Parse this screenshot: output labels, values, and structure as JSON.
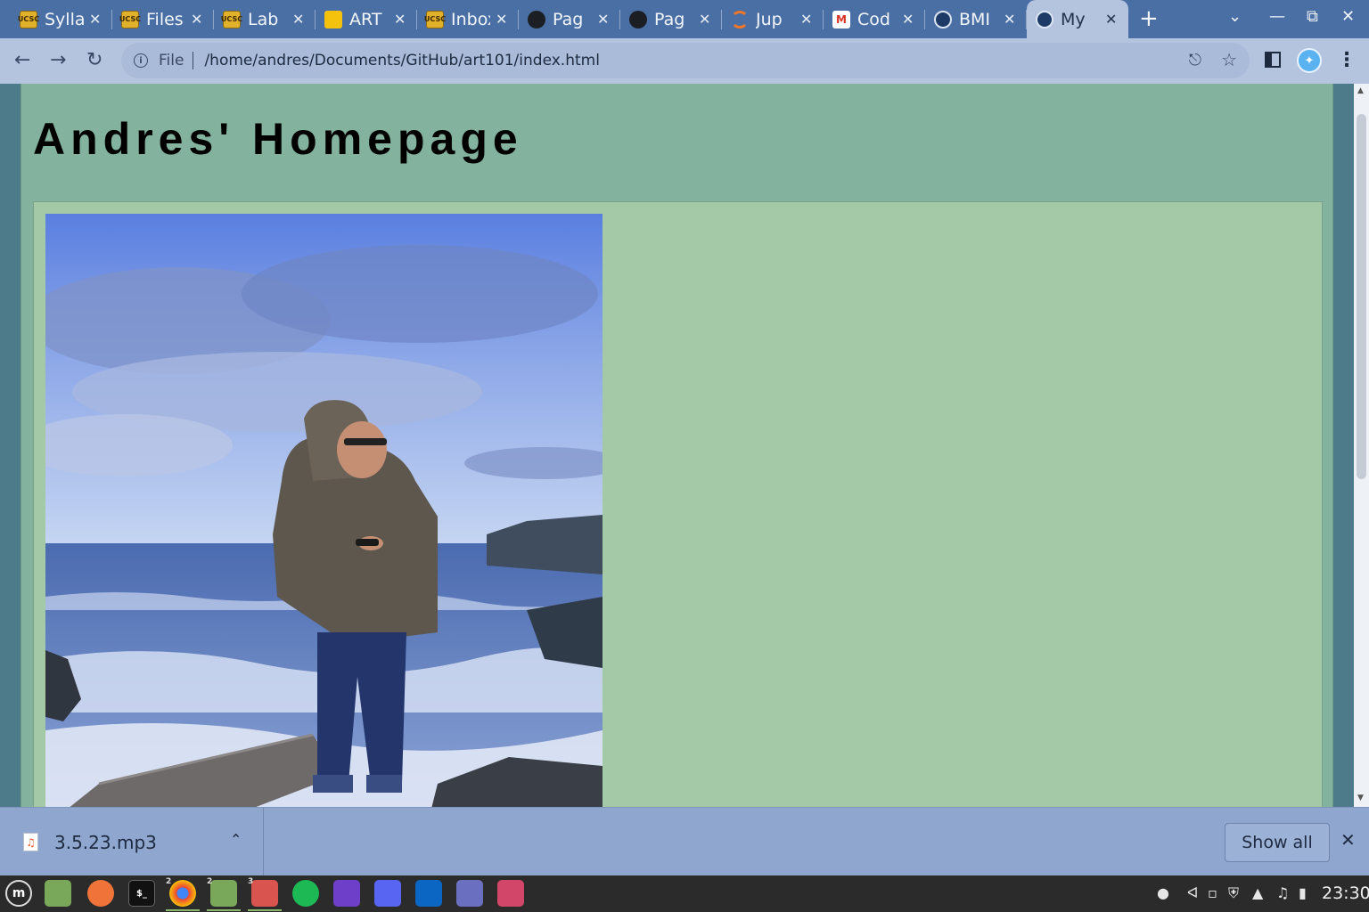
{
  "browser": {
    "tabs": [
      {
        "title": "Syllabus",
        "favicon": "ucsc-icon",
        "kind": "ucsc"
      },
      {
        "title": "Files",
        "favicon": "ucsc-icon",
        "kind": "ucsc"
      },
      {
        "title": "Lab",
        "favicon": "ucsc-icon",
        "kind": "ucsc"
      },
      {
        "title": "ART",
        "favicon": "slides-icon",
        "kind": "slides"
      },
      {
        "title": "Inbox",
        "favicon": "ucsc-icon",
        "kind": "ucsc"
      },
      {
        "title": "Pag",
        "favicon": "github-icon",
        "kind": "gh"
      },
      {
        "title": "Pag",
        "favicon": "github-icon",
        "kind": "gh"
      },
      {
        "title": "Jup",
        "favicon": "jupyter-icon",
        "kind": "jup"
      },
      {
        "title": "Cod",
        "favicon": "gmail-icon",
        "kind": "gmail"
      },
      {
        "title": "BMI",
        "favicon": "globe-icon",
        "kind": "globe"
      },
      {
        "title": "My",
        "favicon": "globe-icon",
        "kind": "globe",
        "active": true
      }
    ],
    "ucsc_badge": "UCSC",
    "address": {
      "scheme_label": "File",
      "url": "/home/andres/Documents/GitHub/art101/index.html"
    }
  },
  "page": {
    "heading": "Andres' Homepage",
    "colors": {
      "page_bg": "#83b39f",
      "content_bg": "#a4c9a7",
      "outer_bg": "#4e7b8a"
    }
  },
  "downloads": {
    "file_name": "3.5.23.mp3",
    "show_all_label": "Show all"
  },
  "taskbar": {
    "chrome_badge": "2",
    "files_badge": "2",
    "app_badge": "3",
    "clock": "23:30"
  }
}
